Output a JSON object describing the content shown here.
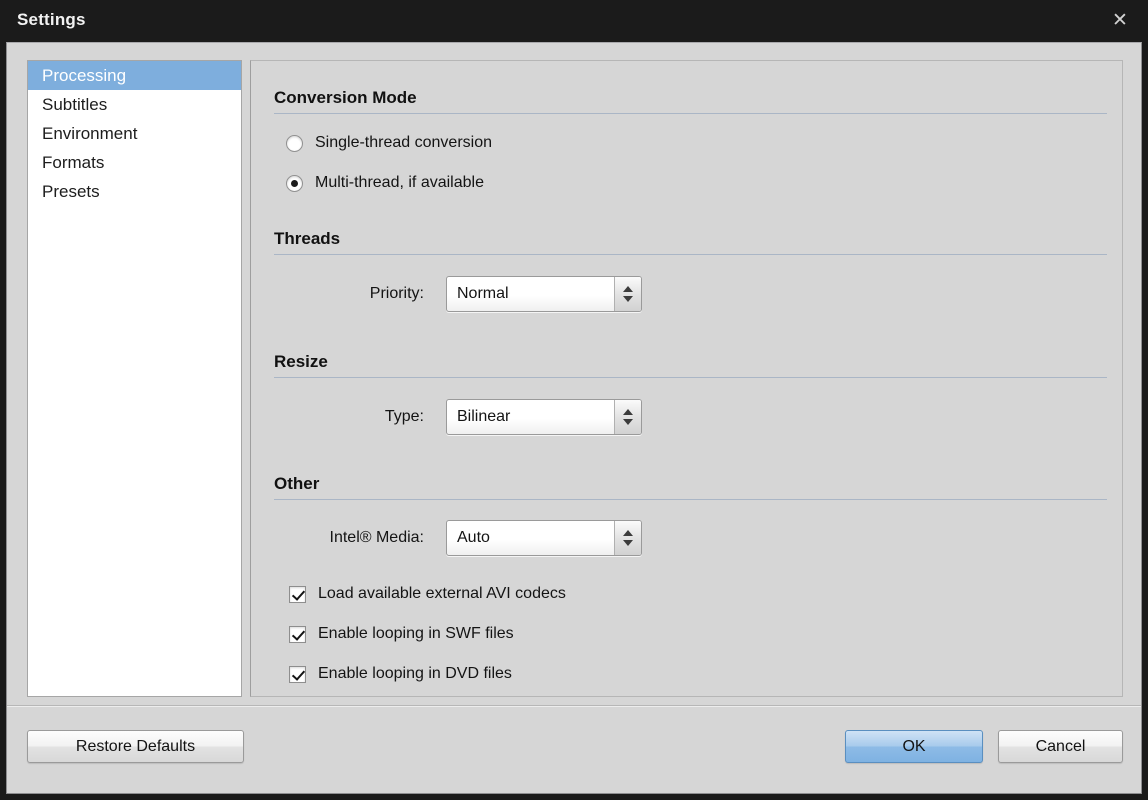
{
  "window": {
    "title": "Settings",
    "close_icon": "close-icon",
    "accent_color": "#7eaedd",
    "body_color": "#d6d6d6",
    "titlebar_color": "#1b1b1b"
  },
  "sidebar": {
    "items": [
      {
        "label": "Processing",
        "selected": true
      },
      {
        "label": "Subtitles",
        "selected": false
      },
      {
        "label": "Environment",
        "selected": false
      },
      {
        "label": "Formats",
        "selected": false
      },
      {
        "label": "Presets",
        "selected": false
      }
    ]
  },
  "content": {
    "sections": [
      {
        "heading": "Conversion Mode"
      },
      {
        "heading": "Threads"
      },
      {
        "heading": "Resize"
      },
      {
        "heading": "Other"
      }
    ],
    "conversion_mode": {
      "options": [
        {
          "label": "Single-thread conversion",
          "checked": false
        },
        {
          "label": "Multi-thread, if available",
          "checked": true
        }
      ]
    },
    "threads": {
      "priority_label": "Priority:",
      "priority_value": "Normal"
    },
    "resize": {
      "type_label": "Type:",
      "type_value": "Bilinear"
    },
    "other": {
      "intel_media_label": "Intel® Media:",
      "intel_media_value": "Auto",
      "checkboxes": [
        {
          "label": "Load available external AVI codecs",
          "checked": true
        },
        {
          "label": "Enable looping in SWF files",
          "checked": true
        },
        {
          "label": "Enable looping in DVD files",
          "checked": true
        }
      ]
    }
  },
  "footer": {
    "restore_defaults": "Restore Defaults",
    "ok": "OK",
    "cancel": "Cancel"
  }
}
